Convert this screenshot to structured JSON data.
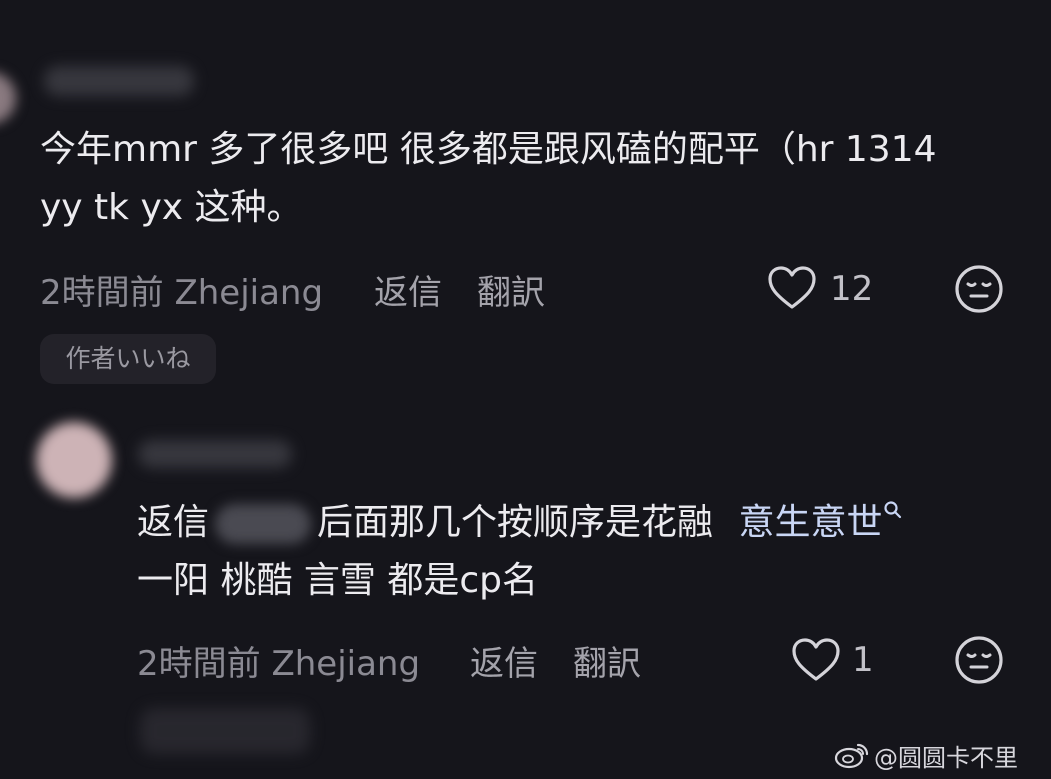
{
  "comment1": {
    "text_line1": "今年mmr 多了很多吧 很多都是跟风磕的配平（hr 1314",
    "text_line2": "yy tk yx 这种。",
    "time": "2時間前 Zhejiang",
    "reply_label": "返信",
    "translate_label": "翻訳",
    "like_count": "12",
    "author_like_badge": "作者いいね"
  },
  "comment2": {
    "reply_prefix": "返信",
    "text_line1": "后面那几个按顺序是花融",
    "link_text": "意生意世",
    "link_icon": "search-icon",
    "text_line2": "一阳 桃酷 言雪 都是cp名",
    "time": "2時間前 Zhejiang",
    "reply_label": "返信",
    "translate_label": "翻訳",
    "like_count": "1"
  },
  "watermark": "@圆圆卡不里",
  "colors": {
    "background": "#15151b",
    "text": "#ecebef",
    "meta": "#8b8a93",
    "link": "#c9d6f5"
  }
}
